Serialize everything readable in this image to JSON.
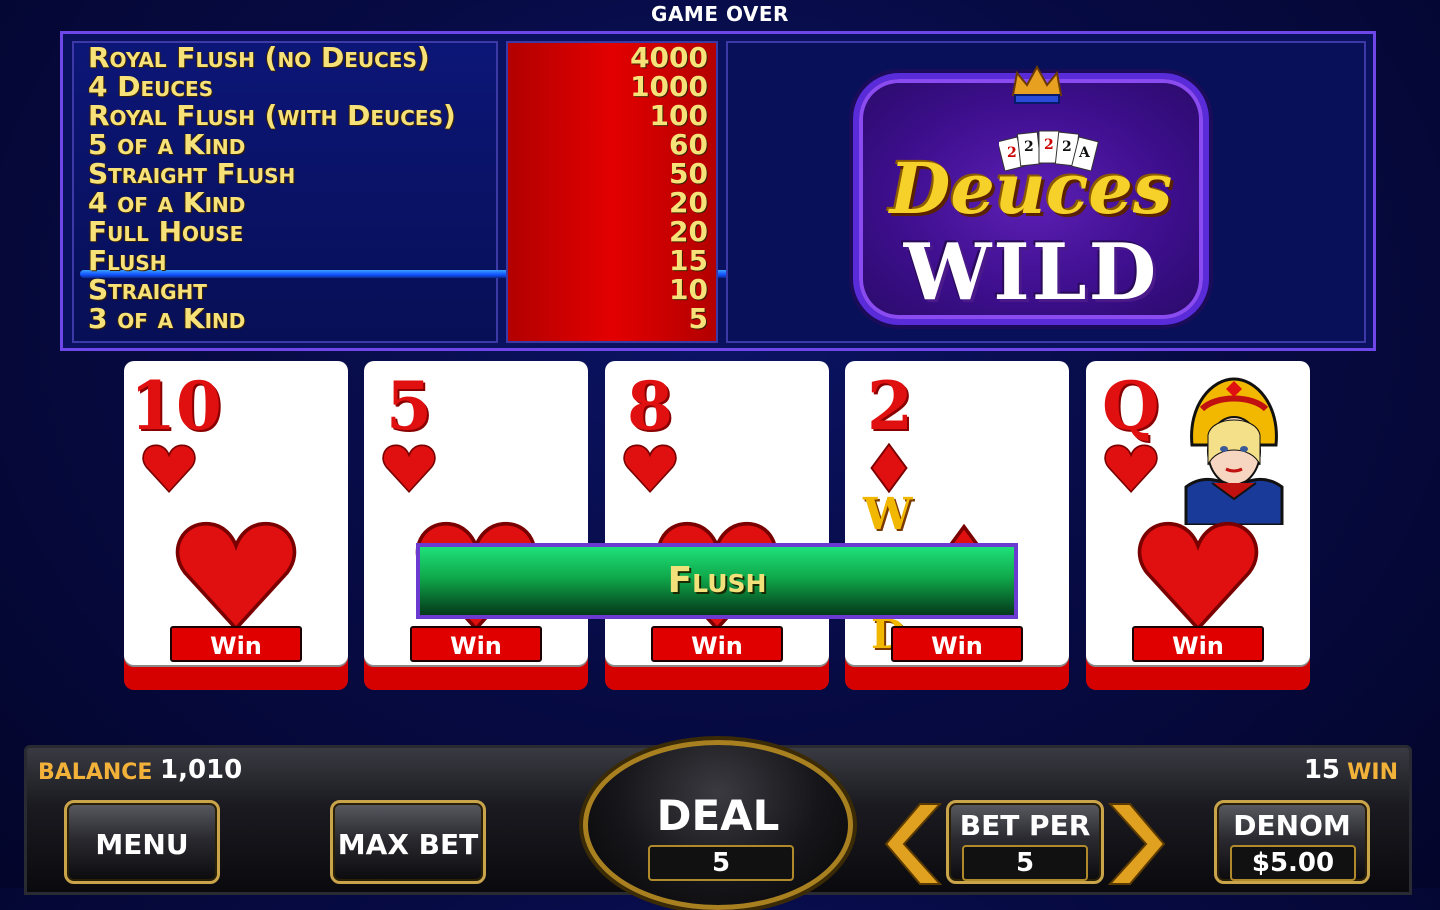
{
  "status": "GAME OVER",
  "paytable": {
    "rows": [
      {
        "hand": "Royal Flush (no Deuces)",
        "pay": "4000"
      },
      {
        "hand": "4 Deuces",
        "pay": "1000"
      },
      {
        "hand": "Royal Flush (with Deuces)",
        "pay": "100"
      },
      {
        "hand": "5 of a Kind",
        "pay": "60"
      },
      {
        "hand": "Straight Flush",
        "pay": "50"
      },
      {
        "hand": "4 of a Kind",
        "pay": "20"
      },
      {
        "hand": "Full House",
        "pay": "20"
      },
      {
        "hand": "Flush",
        "pay": "15"
      },
      {
        "hand": "Straight",
        "pay": "10"
      },
      {
        "hand": "3 of a Kind",
        "pay": "5"
      }
    ],
    "highlighted_hand": "Flush"
  },
  "logo": {
    "line1": "Deuces",
    "line2": "WILD",
    "mini_cards": [
      "2",
      "2",
      "2",
      "2",
      "A"
    ]
  },
  "cards": [
    {
      "rank": "10",
      "suit": "hearts",
      "win_label": "Win"
    },
    {
      "rank": "5",
      "suit": "hearts",
      "win_label": "Win"
    },
    {
      "rank": "8",
      "suit": "hearts",
      "win_label": "Win"
    },
    {
      "rank": "2",
      "suit": "diamonds",
      "win_label": "Win",
      "wild_letters": [
        "W",
        "D"
      ]
    },
    {
      "rank": "Q",
      "suit": "hearts",
      "win_label": "Win"
    }
  ],
  "result_banner": "Flush",
  "console": {
    "balance_label": "BALANCE",
    "balance_value": "1,010",
    "win_value": "15",
    "win_label": "WIN",
    "menu_label": "MENU",
    "max_bet_label": "MAX BET",
    "deal_label": "DEAL",
    "deal_value": "5",
    "bet_per_label": "BET PER",
    "bet_per_value": "5",
    "denom_label": "DENOM",
    "denom_value": "$5.00"
  },
  "colors": {
    "paytable_text": "#f7e27a",
    "card_red": "#e01010",
    "win_button": "#e00000",
    "banner_green": "#0fa84a",
    "gold_accent": "#f2b23a"
  }
}
